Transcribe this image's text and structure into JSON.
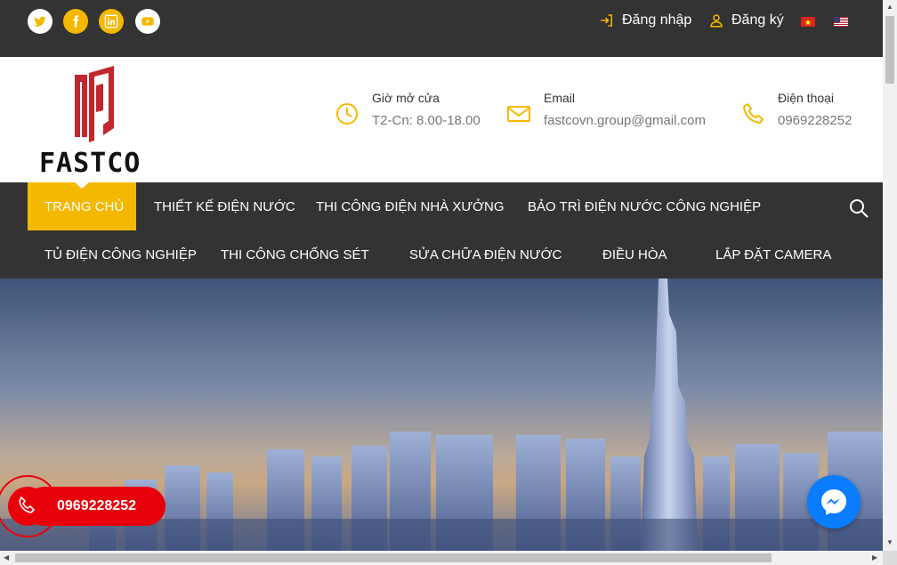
{
  "topbar": {
    "social_icons": [
      "twitter-icon",
      "facebook-icon",
      "linkedin-icon",
      "youtube-icon"
    ],
    "login_label": "Đăng nhập",
    "register_label": "Đăng ký",
    "languages": [
      "vietnamese-flag-icon",
      "us-flag-icon"
    ]
  },
  "header": {
    "logo_text": "FASTCO",
    "hours": {
      "label": "Giờ mở cửa",
      "value": "T2-Cn: 8.00-18.00"
    },
    "email": {
      "label": "Email",
      "value": "fastcovn.group@gmail.com"
    },
    "phone": {
      "label": "Điện thoại",
      "value": "0969228252"
    }
  },
  "nav": {
    "items": [
      "TRANG CHỦ",
      "THIẾT KẾ ĐIỆN NƯỚC",
      "THI CÔNG ĐIỆN NHÀ XƯỞNG",
      "BẢO TRÌ ĐIỆN NƯỚC CÔNG NGHIỆP",
      "TỦ ĐIỆN CÔNG NGHIỆP",
      "THI CÔNG CHỐNG SÉT",
      "SỬA CHỮA ĐIỆN NƯỚC",
      "ĐIỀU HÒA",
      "LẮP ĐẶT CAMERA"
    ],
    "active_index": 0
  },
  "floating": {
    "hotline": "0969228252"
  },
  "colors": {
    "accent": "#f5b800",
    "dark": "#333333",
    "brand_red": "#c1272d",
    "hotline_red": "#e8000b",
    "messenger_blue": "#0a7cff"
  }
}
